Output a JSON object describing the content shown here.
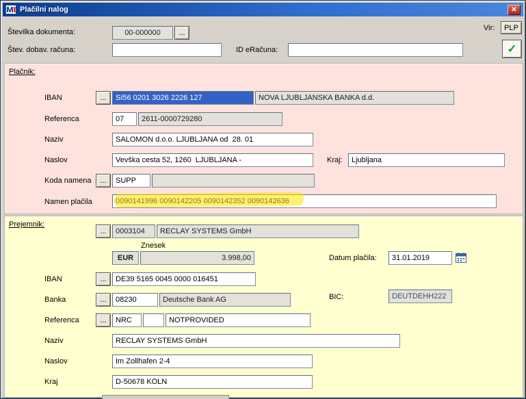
{
  "window": {
    "title": "Plačilni nalog",
    "close_glyph": "✕"
  },
  "icons": {
    "browse": "...",
    "check": "✓"
  },
  "header": {
    "doc_label": "Številka dokumenta:",
    "doc_value": "00-000000",
    "vir_label": "Vir:",
    "vir_button": "PLP",
    "supplier_label": "Štev. dobav. računa:",
    "supplier_value": "",
    "einvoice_label": "ID eRačuna:",
    "einvoice_value": ""
  },
  "payer": {
    "legend": "Plačnik:",
    "iban_label": "IBAN",
    "iban": "SI56 0201 3026 2226 127",
    "bank_name": "NOVA LJUBLJANSKA BANKA d.d.",
    "ref_label": "Referenca",
    "ref_model": "07",
    "ref_number": "2611-0000729280",
    "name_label": "Naziv",
    "name": "SALOMON d.o.o. LJUBLJANA od  28. 01",
    "addr_label": "Naslov",
    "address": "Vevška cesta 52, 1260  LJUBLJANA -",
    "city_label": "Kraj:",
    "city": "Ljubljana",
    "purpose_code_label": "Koda namena",
    "purpose_code": "SUPP",
    "purpose_code_desc": "",
    "purpose_label": "Namen plačila",
    "purpose": "0090141996 0090142205 0090142352 0090142636"
  },
  "recipient": {
    "legend": "Prejemnik:",
    "id": "0003104",
    "display_name": "RECLAY SYSTEMS GmbH",
    "amount_label": "Znesek",
    "currency": "EUR",
    "amount": "3.998,00",
    "date_label": "Datum plačila:",
    "date": "31.01.2019",
    "iban_label": "IBAN",
    "iban": "DE39 5165 0045 0000 016451",
    "bank_label": "Banka",
    "bank_code": "08230",
    "bank_name": "Deutsche Bank AG",
    "bic_label": "BIC:",
    "bic": "DEUTDEHH222",
    "ref_label": "Referenca",
    "ref_model": "NRC",
    "ref_check": "",
    "ref_number": "NOTPROVIDED",
    "name_label": "Naziv",
    "name": "RECLAY SYSTEMS GmbH",
    "addr_label": "Naslov",
    "address": "Im Zollhafen 2-4",
    "city_label": "Kraj",
    "city": "D-50678 KÖLN"
  }
}
